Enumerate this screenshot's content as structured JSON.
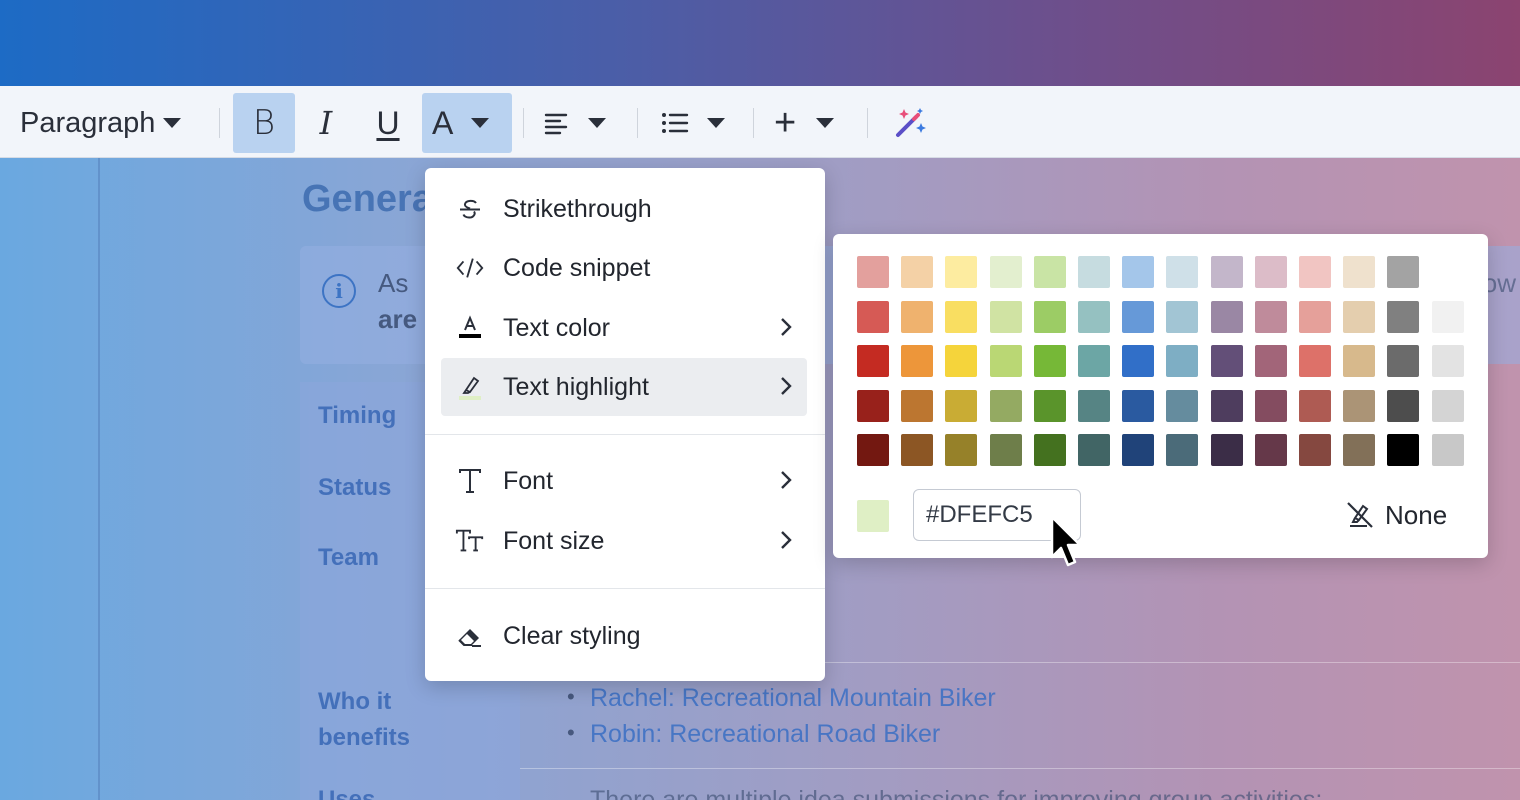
{
  "document": {
    "heading": "Genera",
    "info_line1": "As",
    "info_line2": "are",
    "info_tail": "ow",
    "rows": [
      {
        "label": "Timing"
      },
      {
        "label": "Status"
      },
      {
        "label": "Team"
      },
      {
        "label": "Who it\nbenefits"
      },
      {
        "label": "Uses"
      }
    ],
    "bullets": [
      "Rachel: Recreational Mountain Biker",
      "Robin: Recreational Road Biker"
    ],
    "last_line": "There are multiple idea submissions for improving group activities;"
  },
  "toolbar": {
    "paragraph_label": "Paragraph",
    "bold_label": "B",
    "italic_label": "I",
    "underline_label": "U",
    "textstyle_label": "A",
    "plus_label": "+",
    "icons": {
      "align": "align-left-icon",
      "list": "bullet-list-icon",
      "ai": "magic-wand-icon"
    }
  },
  "menu": {
    "items": [
      {
        "label": "Strikethrough",
        "icon": "strikethrough-icon",
        "submenu": false
      },
      {
        "label": "Code snippet",
        "icon": "code-icon",
        "submenu": false
      },
      {
        "label": "Text color",
        "icon": "text-color-icon",
        "submenu": true
      },
      {
        "label": "Text highlight",
        "icon": "highlighter-icon",
        "submenu": true,
        "highlighted": true
      },
      {
        "label": "Font",
        "icon": "font-icon",
        "submenu": true
      },
      {
        "label": "Font size",
        "icon": "font-size-icon",
        "submenu": true
      },
      {
        "label": "Clear styling",
        "icon": "eraser-icon",
        "submenu": false
      }
    ]
  },
  "palette": {
    "rows": [
      [
        "#e3a09d",
        "#f4d1a6",
        "#fdeca0",
        "#e3efcf",
        "#c9e4a5",
        "#c6dce0",
        "#a4c6ea",
        "#cfe0e8",
        "#c3b6ca",
        "#dcbcc8",
        "#f1c5c2",
        "#efe1cd",
        "#a3a3a3",
        ""
      ],
      [
        "#d65a55",
        "#efb26e",
        "#f9de61",
        "#d0e3a3",
        "#9ccc65",
        "#95c1c1",
        "#6699d8",
        "#a2c5d4",
        "#9a87a4",
        "#bf8b9b",
        "#e5a09a",
        "#e4ceae",
        "#808080",
        "#f1f1f1"
      ],
      [
        "#c42b22",
        "#ed963a",
        "#f5d43b",
        "#bad774",
        "#76b837",
        "#6ca6a5",
        "#316fc8",
        "#7eaec4",
        "#634f78",
        "#a26579",
        "#dd7169",
        "#d7b98c",
        "#6b6b6b",
        "#e3e3e3"
      ],
      [
        "#98211b",
        "#bc7630",
        "#c9ac34",
        "#94aa62",
        "#5a942b",
        "#568484",
        "#2a5aa0",
        "#658c9e",
        "#4e3d5e",
        "#844c60",
        "#ae5b53",
        "#ab9476",
        "#4d4d4d",
        "#d4d4d4"
      ],
      [
        "#731811",
        "#8c5624",
        "#968129",
        "#6e7e4a",
        "#44711f",
        "#416565",
        "#204379",
        "#4b6b79",
        "#3b2d47",
        "#653849",
        "#854840",
        "#827058",
        "#000000",
        "#c8c8c8"
      ]
    ],
    "selected_color": "#DFEFC5",
    "hex_value": "#DFEFC5",
    "none_label": "None"
  }
}
